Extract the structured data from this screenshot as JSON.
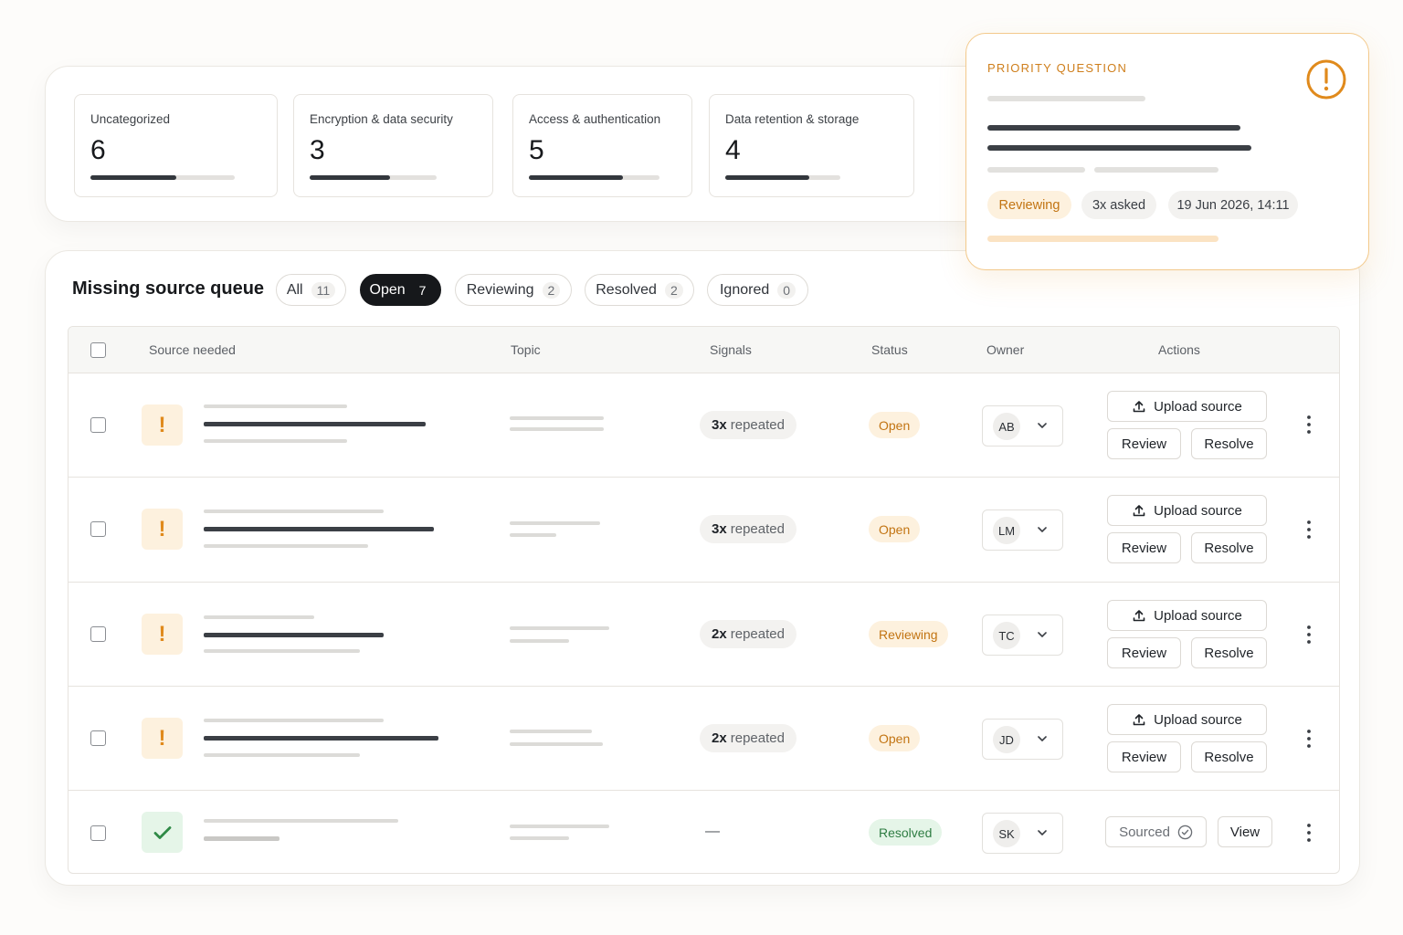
{
  "stats": [
    {
      "label": "Uncategorized",
      "value": "6",
      "progress": 0.59
    },
    {
      "label": "Encryption & data security",
      "value": "3",
      "progress": 0.63
    },
    {
      "label": "Access & authentication",
      "value": "5",
      "progress": 0.72
    },
    {
      "label": "Data retention & storage",
      "value": "4",
      "progress": 0.73
    }
  ],
  "priority": {
    "label": "PRIORITY QUESTION",
    "status": "Reviewing",
    "asked": "3x asked",
    "timestamp": "19 Jun 2026, 14:11",
    "icon": "alert-circle-icon",
    "accent": "#e08a1c"
  },
  "queue": {
    "title": "Missing source queue",
    "filters": [
      {
        "label": "All",
        "count": "11"
      },
      {
        "label": "Open",
        "count": "7",
        "active": true
      },
      {
        "label": "Reviewing",
        "count": "2"
      },
      {
        "label": "Resolved",
        "count": "2"
      },
      {
        "label": "Ignored",
        "count": "0"
      }
    ],
    "columns": {
      "source": "Source needed",
      "topic": "Topic",
      "signals": "Signals",
      "status": "Status",
      "owner": "Owner",
      "actions": "Actions"
    },
    "rows": [
      {
        "signal_count": "3x",
        "signal_label": "repeated",
        "status": "Open",
        "owner": "AB"
      },
      {
        "signal_count": "3x",
        "signal_label": "repeated",
        "status": "Open",
        "owner": "LM"
      },
      {
        "signal_count": "2x",
        "signal_label": "repeated",
        "status": "Reviewing",
        "owner": "TC"
      },
      {
        "signal_count": "2x",
        "signal_label": "repeated",
        "status": "Open",
        "owner": "JD"
      },
      {
        "signal_dash": "—",
        "status": "Resolved",
        "owner": "SK"
      }
    ],
    "actions": {
      "upload": "Upload source",
      "review": "Review",
      "resolve": "Resolve",
      "sourced": "Sourced",
      "view": "View"
    }
  },
  "colors": {
    "warning": "#e08a1c",
    "success": "#2f8a46",
    "active_filter": "#16181b"
  }
}
